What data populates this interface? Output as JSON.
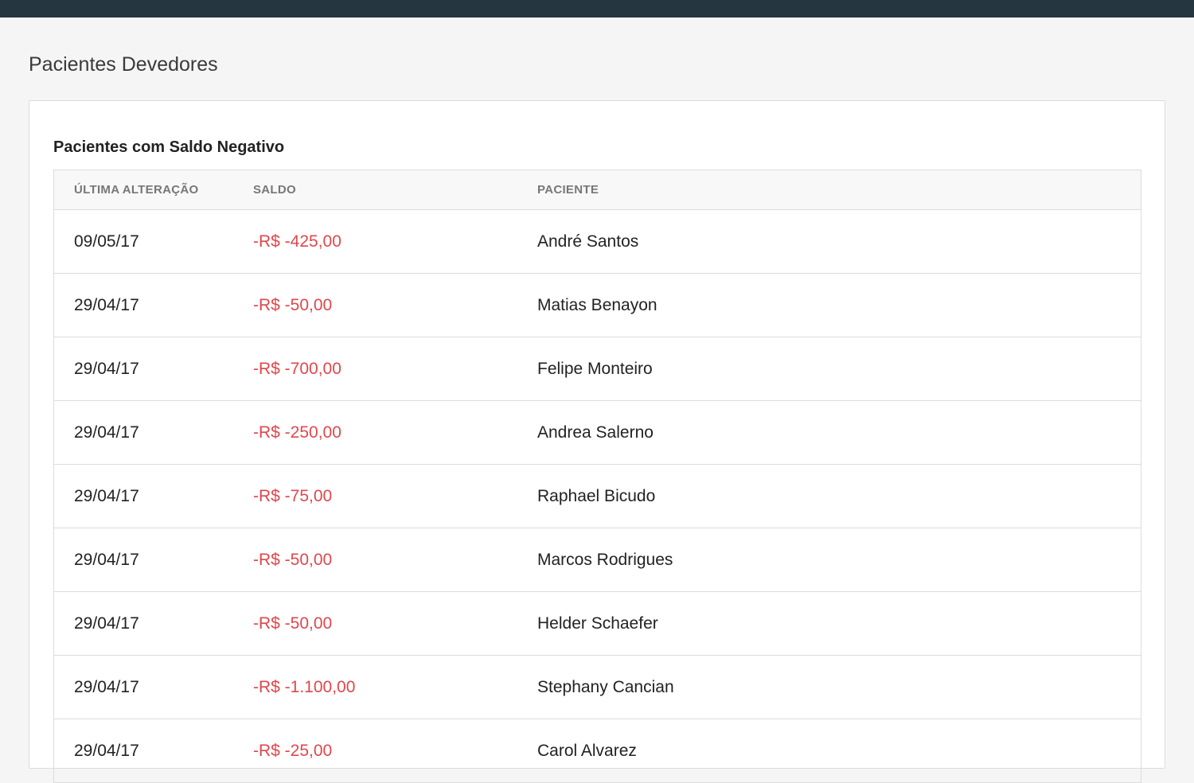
{
  "page": {
    "title": "Pacientes Devedores"
  },
  "card": {
    "title": "Pacientes com Saldo Negativo"
  },
  "table": {
    "columns": [
      "ÚLTIMA ALTERAÇÃO",
      "SALDO",
      "PACIENTE"
    ],
    "rows": [
      {
        "date": "09/05/17",
        "balance": "-R$ -425,00",
        "patient": "André Santos"
      },
      {
        "date": "29/04/17",
        "balance": "-R$ -50,00",
        "patient": "Matias Benayon"
      },
      {
        "date": "29/04/17",
        "balance": "-R$ -700,00",
        "patient": "Felipe Monteiro"
      },
      {
        "date": "29/04/17",
        "balance": "-R$ -250,00",
        "patient": "Andrea Salerno"
      },
      {
        "date": "29/04/17",
        "balance": "-R$ -75,00",
        "patient": "Raphael Bicudo"
      },
      {
        "date": "29/04/17",
        "balance": "-R$ -50,00",
        "patient": "Marcos Rodrigues"
      },
      {
        "date": "29/04/17",
        "balance": "-R$ -50,00",
        "patient": "Helder Schaefer"
      },
      {
        "date": "29/04/17",
        "balance": "-R$ -1.100,00",
        "patient": "Stephany Cancian"
      },
      {
        "date": "29/04/17",
        "balance": "-R$ -25,00",
        "patient": "Carol Alvarez"
      }
    ]
  },
  "colors": {
    "topbar": "#263640",
    "negative_balance": "#e0474c"
  }
}
